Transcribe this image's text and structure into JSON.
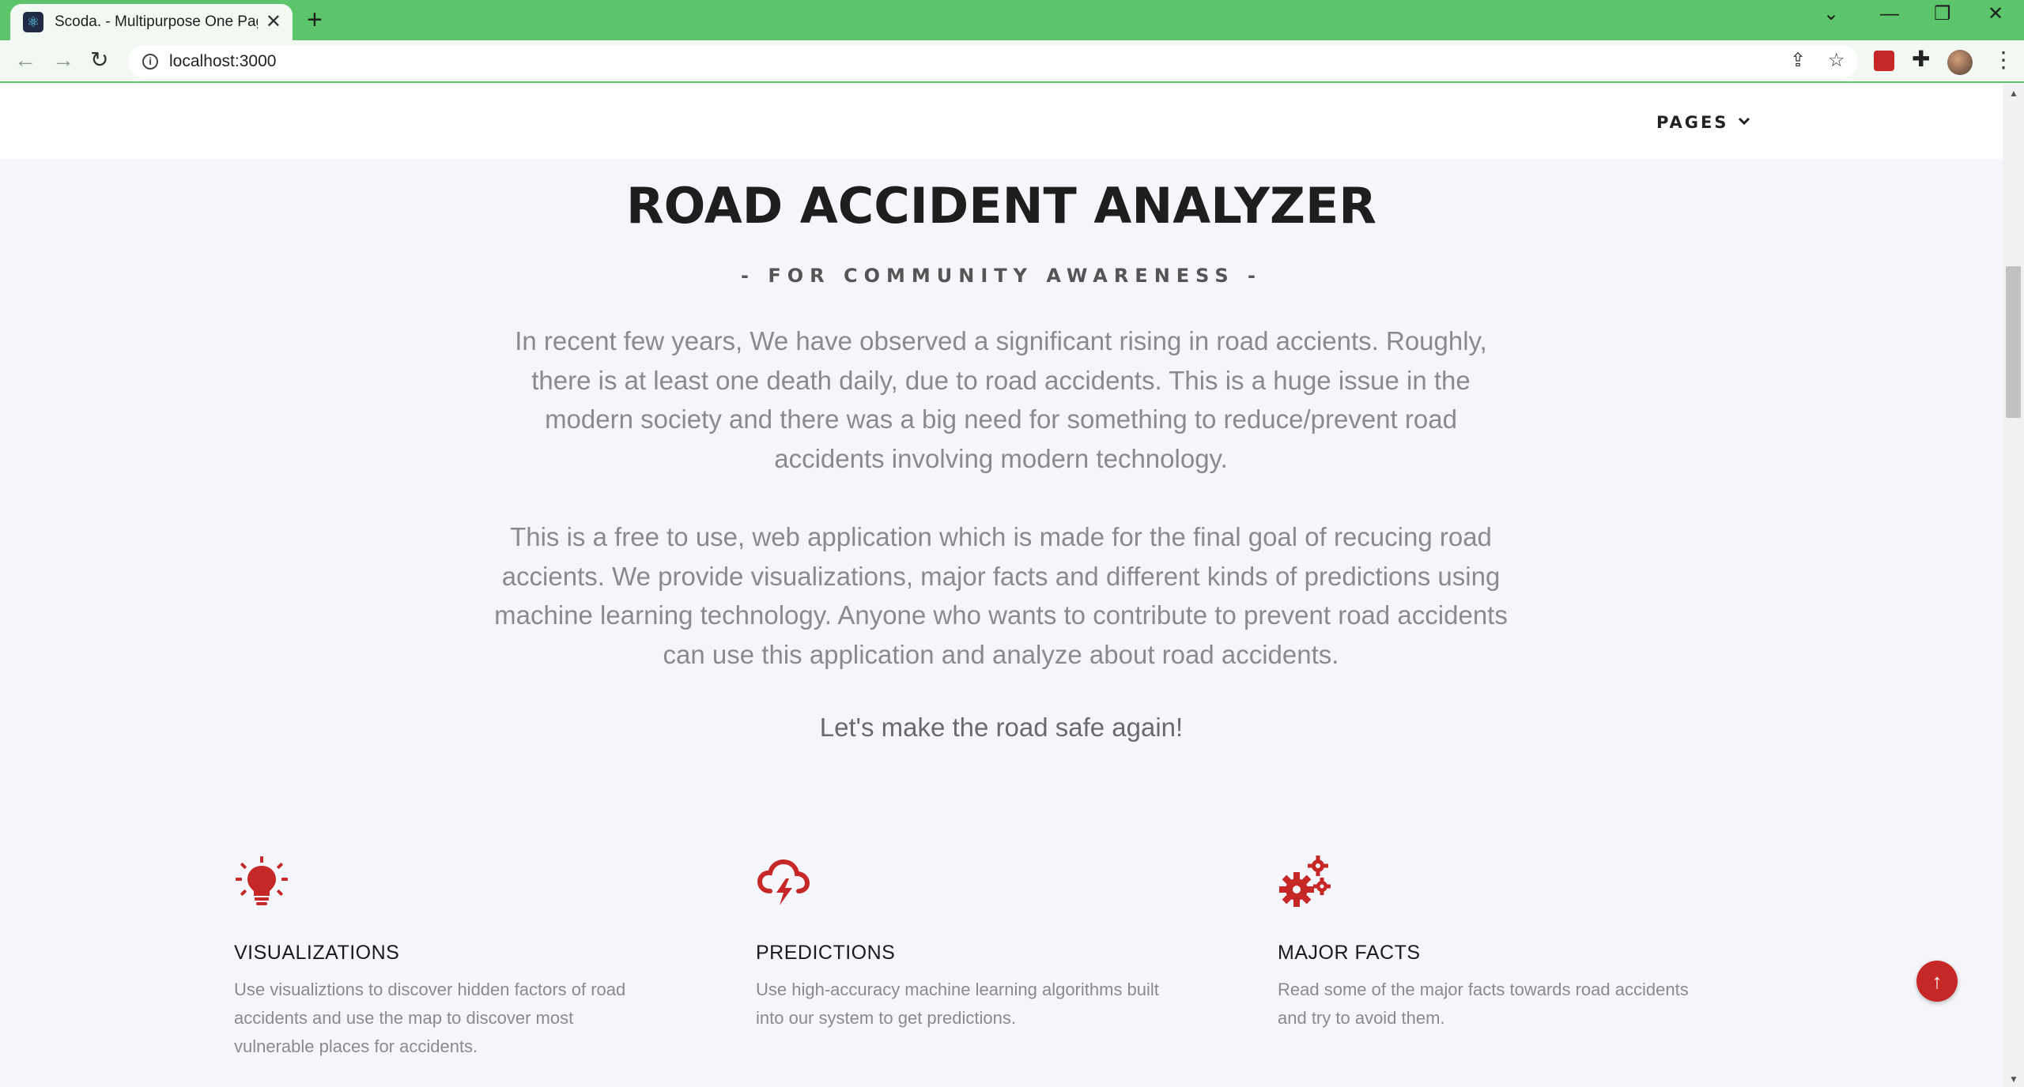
{
  "browser": {
    "tab_title": "Scoda. - Multipurpose One Page",
    "tab_favicon": "react-icon",
    "new_tab": "+",
    "url": "localhost:3000",
    "controls": {
      "dropdown": "⌄",
      "minimize": "—",
      "restore": "❐",
      "close": "✕"
    }
  },
  "nav": {
    "pages_label": "PAGES",
    "pages_chevron": "⌄"
  },
  "hero": {
    "title": "ROAD ACCIDENT ANALYZER",
    "subtitle": "- FOR COMMUNITY AWARENESS -",
    "paragraph1": "In recent few years, We have observed a significant rising in road accients. Roughly, there is at least one death daily, due to road accidents. This is a huge issue in the modern society and there was a big need for something to reduce/prevent road accidents involving modern technology.",
    "paragraph2": "This is a free to use, web application which is made for the final goal of recucing road accients. We provide visualizations, major facts and different kinds of predictions using machine learning technology. Anyone who wants to contribute to prevent road accidents can use this application and analyze about road accidents.",
    "tagline": "Let's make the road safe again!"
  },
  "features": [
    {
      "icon": "lightbulb-icon",
      "title": "VISUALIZATIONS",
      "text": "Use visualiztions to discover hidden factors of road accidents and use the map to discover most vulnerable places for accidents."
    },
    {
      "icon": "storm-cloud-icon",
      "title": "PREDICTIONS",
      "text": "Use high-accuracy machine learning algorithms built into our system to get predictions."
    },
    {
      "icon": "gears-icon",
      "title": "MAJOR FACTS",
      "text": "Read some of the major facts towards road accidents and try to avoid them."
    }
  ],
  "back_to_top": "↑",
  "colors": {
    "accent": "#c62828",
    "chrome": "#5cc46a",
    "page_bg": "#f5f6fb"
  }
}
